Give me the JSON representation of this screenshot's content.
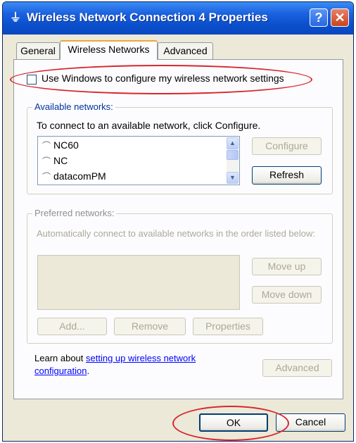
{
  "window": {
    "title": "Wireless Network Connection 4 Properties",
    "help_label": "?",
    "close_label": "✕",
    "title_icon": "network-connection-icon"
  },
  "tabs": [
    {
      "label": "General",
      "active": false
    },
    {
      "label": "Wireless Networks",
      "active": true
    },
    {
      "label": "Advanced",
      "active": false
    }
  ],
  "use_windows_checkbox": {
    "label": "Use Windows to configure my wireless network settings",
    "checked": false
  },
  "available": {
    "legend": "Available networks:",
    "instruction": "To connect to an available network, click Configure.",
    "networks": [
      "NC60",
      "NC",
      "datacomPM"
    ],
    "configure_label": "Configure",
    "refresh_label": "Refresh"
  },
  "preferred": {
    "legend": "Preferred networks:",
    "description": "Automatically connect to available networks in the order listed below:",
    "move_up_label": "Move up",
    "move_down_label": "Move down",
    "add_label": "Add...",
    "remove_label": "Remove",
    "properties_label": "Properties"
  },
  "learn": {
    "prefix": "Learn about ",
    "link_text_1": "setting up wireless network",
    "link_text_2": "configuration",
    "suffix": "."
  },
  "advanced_button_label": "Advanced",
  "ok_label": "OK",
  "cancel_label": "Cancel",
  "highlight_color": "#d8262e"
}
